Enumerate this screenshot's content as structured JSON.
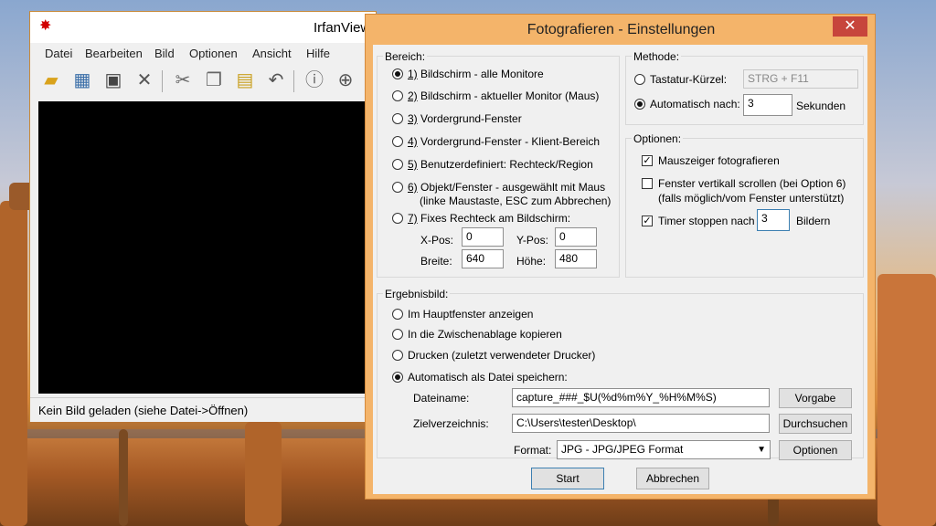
{
  "irfanview": {
    "title": "IrfanView",
    "menu": [
      "Datei",
      "Bearbeiten",
      "Bild",
      "Optionen",
      "Ansicht",
      "Hilfe"
    ],
    "status": "Kein Bild geladen (siehe Datei->Öffnen)"
  },
  "dialog": {
    "title": "Fotografieren - Einstellungen",
    "close": "✕",
    "bereich": {
      "legend": "Bereich:",
      "options": [
        {
          "num": "1)",
          "label": " Bildschirm - alle Monitore",
          "selected": true
        },
        {
          "num": "2)",
          "label": " Bildschirm - aktueller Monitor (Maus)",
          "selected": false
        },
        {
          "num": "3)",
          "label": " Vordergrund-Fenster",
          "selected": false
        },
        {
          "num": "4)",
          "label": " Vordergrund-Fenster - Klient-Bereich",
          "selected": false
        },
        {
          "num": "5)",
          "label": " Benutzerdefiniert: Rechteck/Region",
          "selected": false
        },
        {
          "num": "6)",
          "label": " Objekt/Fenster - ausgewählt mit Maus",
          "line2": "(linke Maustaste, ESC zum Abbrechen)",
          "selected": false
        },
        {
          "num": "7)",
          "label": " Fixes Rechteck am Bildschirm:",
          "selected": false
        }
      ],
      "xpos_label": "X-Pos:",
      "xpos": "0",
      "ypos_label": "Y-Pos:",
      "ypos": "0",
      "breite_label": "Breite:",
      "breite": "640",
      "hoehe_label": "Höhe:",
      "hoehe": "480"
    },
    "methode": {
      "legend": "Methode:",
      "tastatur_label": "Tastatur-Kürzel:",
      "tastatur_value": "STRG + F11",
      "auto_label": "Automatisch nach:",
      "auto_value": "3",
      "auto_unit": "Sekunden"
    },
    "optionen": {
      "legend": "Optionen:",
      "mauszeiger": "Mauszeiger fotografieren",
      "scroll": "Fenster vertikall scrollen (bei Option 6)",
      "scroll_line2": "(falls möglich/vom Fenster unterstützt)",
      "timer": "Timer stoppen nach",
      "timer_value": "3",
      "timer_unit": "Bildern"
    },
    "ergebnis": {
      "legend": "Ergebnisbild:",
      "options": [
        "Im Hauptfenster anzeigen",
        "In die Zwischenablage kopieren",
        "Drucken (zuletzt verwendeter Drucker)",
        "Automatisch als Datei speichern:"
      ],
      "dateiname_label": "Dateiname:",
      "dateiname": "capture_###_$U(%d%m%Y_%H%M%S)",
      "vorgabe": "Vorgabe",
      "ziel_label": "Zielverzeichnis:",
      "ziel": "C:\\Users\\tester\\Desktop\\",
      "durchsuchen": "Durchsuchen",
      "format_label": "Format:",
      "format": "JPG - JPG/JPEG Format",
      "optionen_btn": "Optionen"
    },
    "start": "Start",
    "abbrechen": "Abbrechen"
  }
}
